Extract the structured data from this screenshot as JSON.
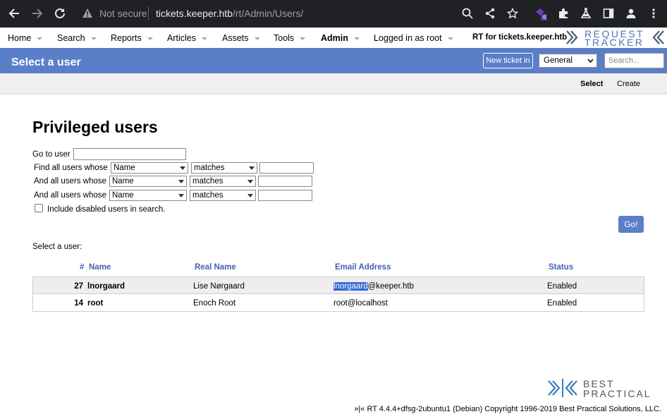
{
  "browser": {
    "security_label": "Not secure",
    "url_host": "tickets.keeper.htb",
    "url_path": "/rt/Admin/Users/",
    "extension_badge": "6"
  },
  "topmenu": {
    "items": [
      "Home",
      "Search",
      "Reports",
      "Articles",
      "Assets",
      "Tools",
      "Admin",
      "Logged in as root"
    ],
    "rt_for": "RT for tickets.keeper.htb",
    "logo_line1": "REQUEST",
    "logo_line2": "TRACKER"
  },
  "titlebar": {
    "title": "Select a user",
    "new_ticket_label": "New ticket in",
    "queue_selected": "General",
    "search_placeholder": "Search..."
  },
  "pagemenu": {
    "select_label": "Select",
    "create_label": "Create"
  },
  "main": {
    "heading": "Privileged users",
    "goto_label": "Go to user",
    "find_label": "Find all users whose",
    "and_label": "And all users whose",
    "field_option": "Name",
    "op_option": "matches",
    "include_disabled_label": "Include disabled users in search.",
    "go_label": "Go!",
    "select_user_label": "Select a user:"
  },
  "table": {
    "headers": {
      "id": "#",
      "name": "Name",
      "real_name": "Real Name",
      "email": "Email Address",
      "status": "Status"
    },
    "rows": [
      {
        "id": "27",
        "name": "lnorgaard",
        "real_name": "Lise Nørgaard",
        "email_highlight": "lnorgaard",
        "email_rest": "@keeper.htb",
        "status": "Enabled"
      },
      {
        "id": "14",
        "name": "root",
        "real_name": "Enoch Root",
        "email_highlight": "",
        "email_rest": "root@localhost",
        "status": "Enabled"
      }
    ]
  },
  "footer": {
    "logo_line1": "BEST",
    "logo_line2": "PRACTICAL",
    "copyright": "»|« RT 4.4.4+dfsg-2ubuntu1 (Debian) Copyright 1996-2019 Best Practical Solutions, LLC."
  }
}
